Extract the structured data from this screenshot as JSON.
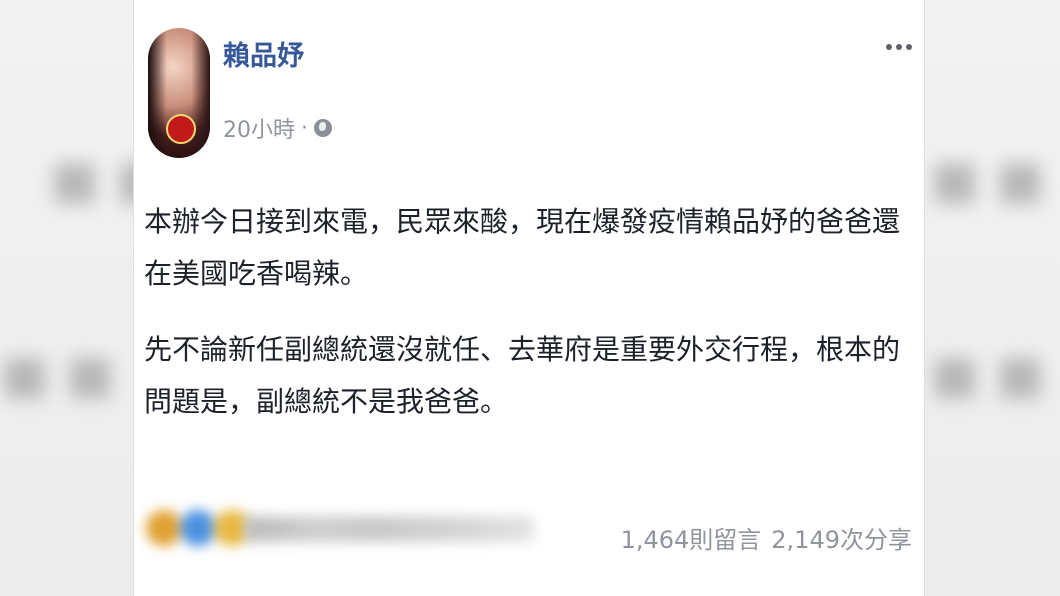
{
  "author": {
    "name": "賴品妤"
  },
  "post": {
    "time": "20小時",
    "separator": "·",
    "paragraphs": [
      "本辦今日接到來電，民眾來酸，現在爆發疫情賴品妤的爸爸還在美國吃香喝辣。",
      "先不論新任副總統還沒就任、去華府是重要外交行程，根本的問題是，副總統不是我爸爸。"
    ]
  },
  "stats": {
    "comments": "1,464則留言",
    "shares": "2,149次分享"
  },
  "icons": {
    "privacy": "globe-icon",
    "menu": "more-icon"
  },
  "colors": {
    "author_link": "#365899",
    "meta_gray": "#90949c",
    "text": "#1d2129"
  }
}
